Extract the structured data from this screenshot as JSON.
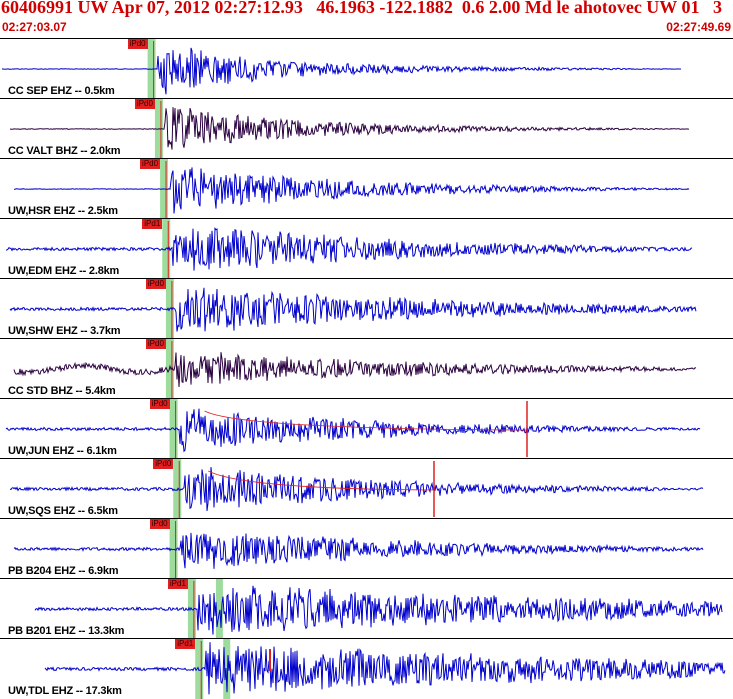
{
  "header": {
    "title": "60406991 UW Apr 07, 2012 02:27:12.93   46.1963 -122.1882  0.6 2.00 Md le ahotovec UW 01   3",
    "start_time": "02:27:03.07",
    "end_time": "02:27:49.69"
  },
  "colors": {
    "title": "#d00000",
    "trace_blue": "#0000cc",
    "trace_purple": "#2a0040",
    "pick": "#e02020",
    "window": "#9edc9e"
  },
  "traces": [
    {
      "label": "CC SEP EHZ -- 0.5km",
      "pick": "iPd0",
      "color": "purple_blue",
      "onset": 0.215,
      "end": 0.93,
      "amp": 1.0,
      "decay": 2.0
    },
    {
      "label": "CC VALT BHZ -- 2.0km",
      "pick": "iPd0",
      "color": "purple",
      "onset": 0.225,
      "end": 0.94,
      "amp": 0.85,
      "decay": 1.5
    },
    {
      "label": "UW,HSR EHZ -- 2.5km",
      "pick": "iPd0",
      "color": "blue",
      "onset": 0.232,
      "end": 0.94,
      "amp": 0.9,
      "decay": 1.2
    },
    {
      "label": "UW,EDM EHZ -- 2.8km",
      "pick": "iPd1",
      "color": "blue",
      "onset": 0.235,
      "end": 0.945,
      "amp": 1.0,
      "decay": 0.9
    },
    {
      "label": "UW,SHW EHZ -- 3.7km",
      "pick": "iPd0",
      "color": "blue",
      "onset": 0.24,
      "end": 0.95,
      "amp": 0.9,
      "decay": 0.7
    },
    {
      "label": "CC STD BHZ -- 5.4km",
      "pick": "iPd0",
      "color": "purple",
      "onset": 0.24,
      "end": 0.95,
      "amp": 0.7,
      "decay": 0.8
    },
    {
      "label": "UW,JUN EHZ -- 6.1km",
      "pick": "iPd0",
      "color": "blue",
      "onset": 0.245,
      "end": 0.955,
      "amp": 0.85,
      "decay": 1.0
    },
    {
      "label": "UW,SQS EHZ -- 6.5km",
      "pick": "iPd0",
      "color": "blue",
      "onset": 0.25,
      "end": 0.96,
      "amp": 0.9,
      "decay": 1.0
    },
    {
      "label": "PB B204 EHZ -- 6.9km",
      "pick": "iPd0",
      "color": "blue",
      "onset": 0.245,
      "end": 0.96,
      "amp": 0.8,
      "decay": 0.8
    },
    {
      "label": "PB B201 EHZ -- 13.3km",
      "pick": "iPd1",
      "color": "blue",
      "onset": 0.27,
      "end": 0.985,
      "amp": 0.9,
      "decay": 0.35
    },
    {
      "label": "UW,TDL EHZ -- 17.3km",
      "pick": "iPd1",
      "color": "blue",
      "onset": 0.28,
      "end": 0.99,
      "amp": 0.95,
      "decay": 0.35
    }
  ]
}
